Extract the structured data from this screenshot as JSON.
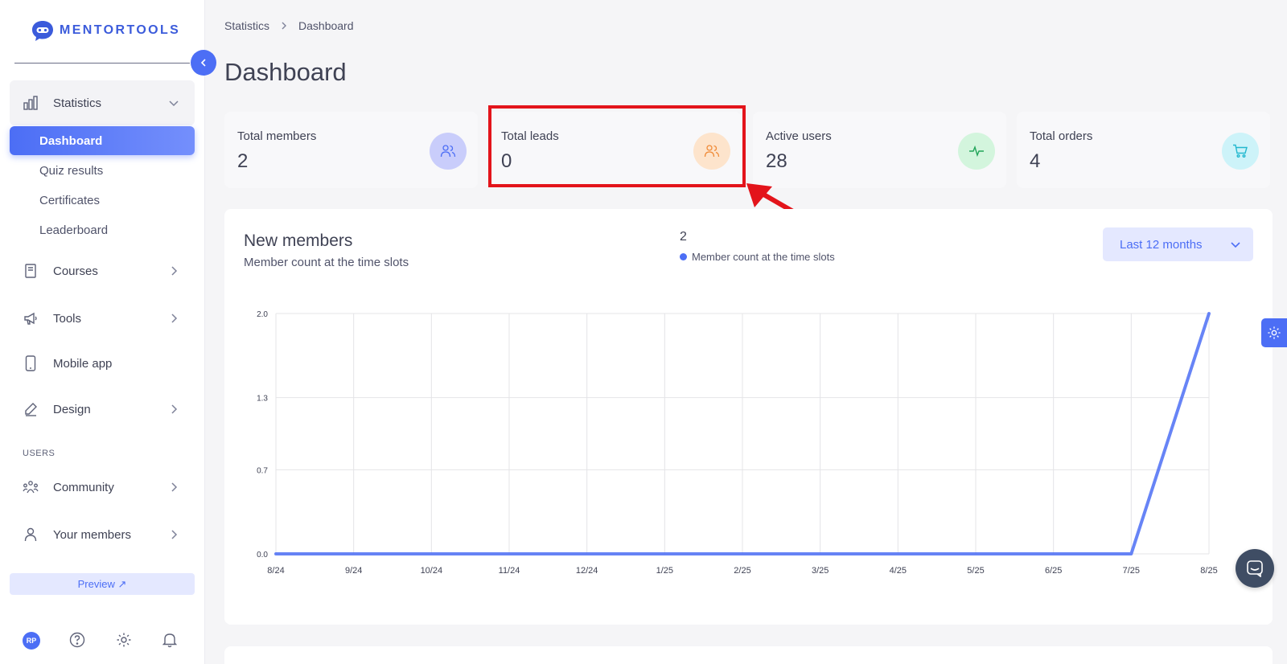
{
  "brand": {
    "name": "MENTORTOOLS"
  },
  "sidebar": {
    "statistics": {
      "label": "Statistics",
      "icon": "bar-chart-icon"
    },
    "sub_items": [
      {
        "label": "Dashboard",
        "active": true
      },
      {
        "label": "Quiz results"
      },
      {
        "label": "Certificates"
      },
      {
        "label": "Leaderboard"
      }
    ],
    "items": [
      {
        "label": "Courses",
        "icon": "book-icon"
      },
      {
        "label": "Tools",
        "icon": "megaphone-icon"
      },
      {
        "label": "Mobile app",
        "icon": "mobile-icon"
      },
      {
        "label": "Design",
        "icon": "pencil-icon"
      }
    ],
    "users_section_label": "USERS",
    "user_items": [
      {
        "label": "Community",
        "icon": "community-icon"
      },
      {
        "label": "Your members",
        "icon": "user-icon"
      }
    ],
    "preview_label": "Preview ↗",
    "avatar_initials": "RP"
  },
  "breadcrumb": {
    "parent": "Statistics",
    "current": "Dashboard"
  },
  "page_title": "Dashboard",
  "stats": [
    {
      "label": "Total members",
      "value": "2",
      "icon": "users-icon",
      "color": "#4c6ef5",
      "bg": "#c9cdfb"
    },
    {
      "label": "Total leads",
      "value": "0",
      "icon": "users-icon",
      "color": "#f08c3a",
      "bg": "#fde4cc"
    },
    {
      "label": "Active users",
      "value": "28",
      "icon": "activity-icon",
      "color": "#22a55a",
      "bg": "#d3f5dd"
    },
    {
      "label": "Total orders",
      "value": "4",
      "icon": "cart-icon",
      "color": "#22b8cf",
      "bg": "#cdf3f9"
    }
  ],
  "chart_card": {
    "title": "New members",
    "subtitle": "Member count at the time slots",
    "total": "2",
    "legend_label": "Member count at the time slots",
    "range_label": "Last 12 months"
  },
  "chart_data": {
    "type": "line",
    "x": [
      "8/24",
      "9/24",
      "10/24",
      "11/24",
      "12/24",
      "1/25",
      "2/25",
      "3/25",
      "4/25",
      "5/25",
      "6/25",
      "7/25",
      "8/25"
    ],
    "series": [
      {
        "name": "Member count at the time slots",
        "values": [
          0,
          0,
          0,
          0,
          0,
          0,
          0,
          0,
          0,
          0,
          0,
          0,
          2
        ]
      }
    ],
    "yticks": [
      "0.0",
      "0.7",
      "1.3",
      "2.0"
    ],
    "ylim": [
      0,
      2
    ],
    "grid": true,
    "color": "#4c6ef5"
  }
}
